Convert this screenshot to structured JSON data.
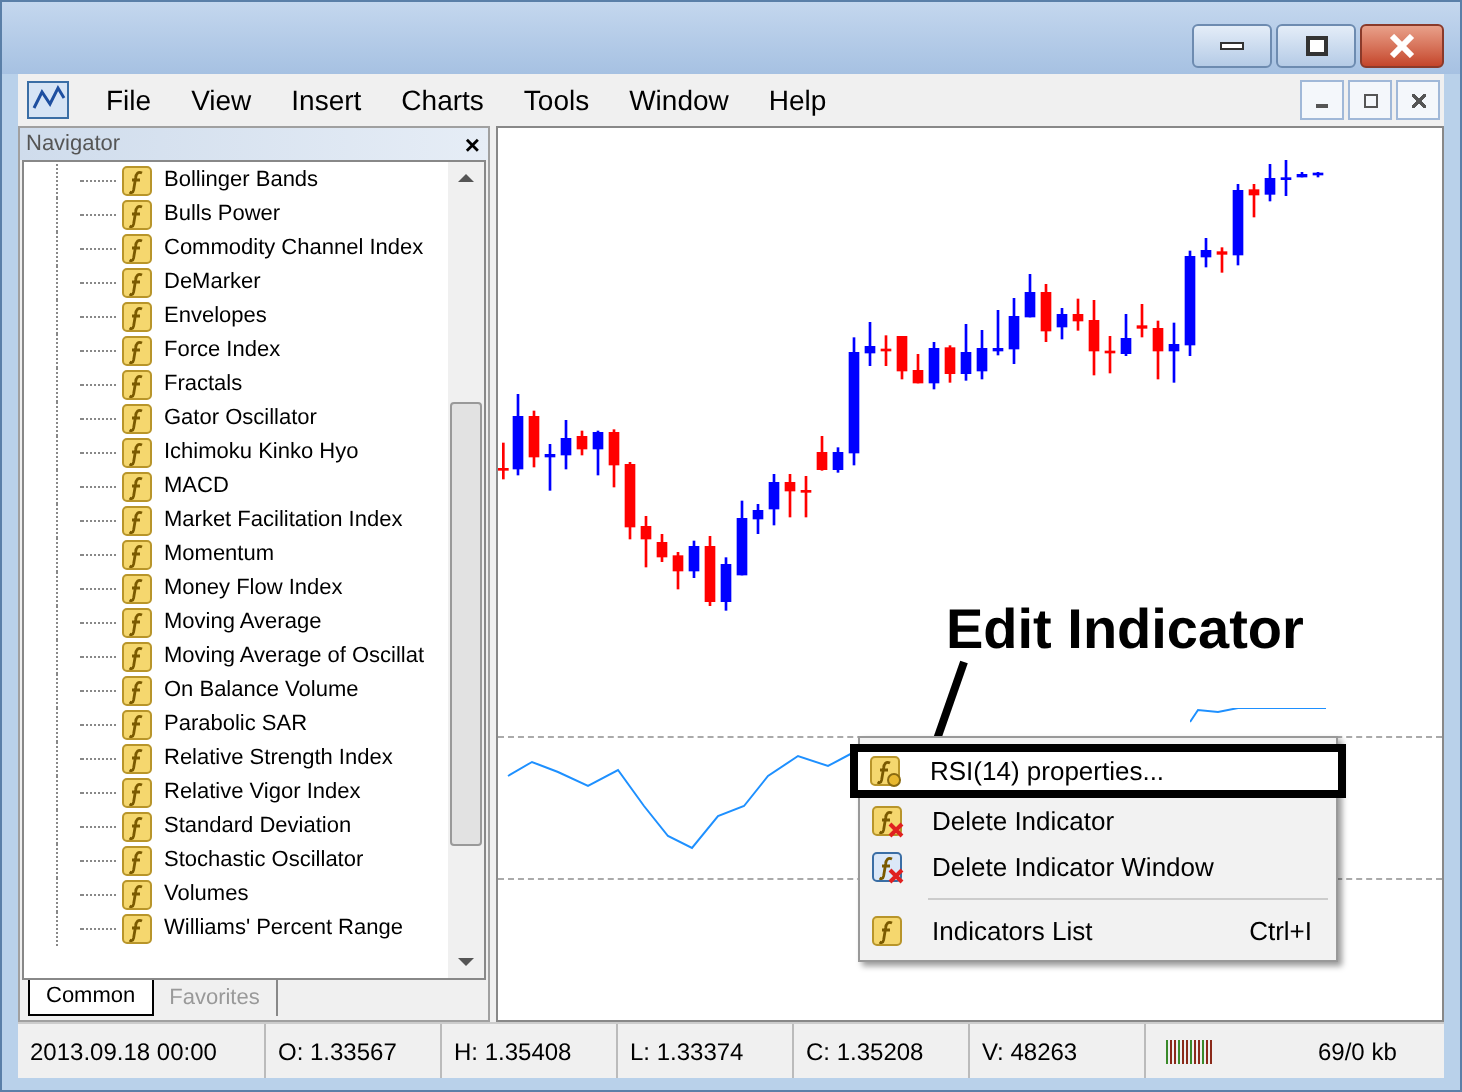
{
  "menu_bar": {
    "items": [
      "File",
      "View",
      "Insert",
      "Charts",
      "Tools",
      "Window",
      "Help"
    ]
  },
  "navigator": {
    "title": "Navigator",
    "close": "×",
    "items": [
      "Bollinger Bands",
      "Bulls Power",
      "Commodity Channel Index",
      "DeMarker",
      "Envelopes",
      "Force Index",
      "Fractals",
      "Gator Oscillator",
      "Ichimoku Kinko Hyo",
      "MACD",
      "Market Facilitation Index",
      "Momentum",
      "Money Flow Index",
      "Moving Average",
      "Moving Average of Oscillat",
      "On Balance Volume",
      "Parabolic SAR",
      "Relative Strength Index",
      "Relative Vigor Index",
      "Standard Deviation",
      "Stochastic Oscillator",
      "Volumes",
      "Williams' Percent Range"
    ],
    "tabs": [
      {
        "label": "Common",
        "selected": true
      },
      {
        "label": "Favorites",
        "selected": false
      }
    ]
  },
  "callout": {
    "text": "Edit Indicator"
  },
  "context_menu": [
    {
      "kind": "item",
      "label": "RSI(14) properties...",
      "highlighted": true
    },
    {
      "kind": "item",
      "label": "Delete Indicator",
      "highlighted": false
    },
    {
      "kind": "item",
      "label": "Delete Indicator Window",
      "highlighted": false
    },
    {
      "kind": "separator"
    },
    {
      "kind": "item",
      "label": "Indicators List",
      "shortcut": "Ctrl+I",
      "highlighted": false
    }
  ],
  "status_bar": [
    "2013.09.18 00:00",
    "O: 1.33567",
    "H: 1.35408",
    "L: 1.33374",
    "C: 1.35208",
    "V: 48263",
    "69/0 kb"
  ]
}
